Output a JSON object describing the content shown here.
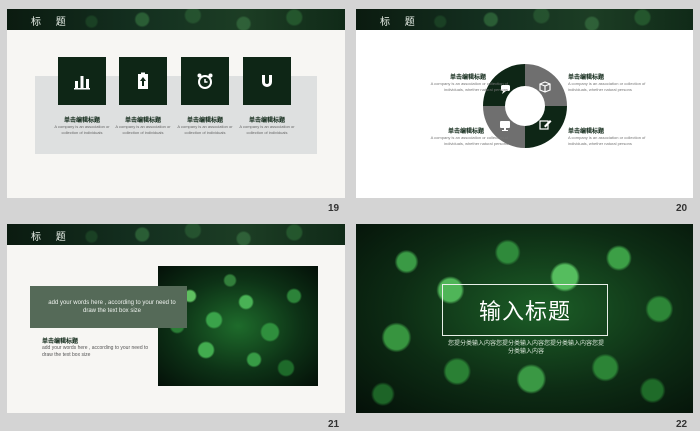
{
  "slides": [
    {
      "number": "19",
      "header": "标 题",
      "items": [
        {
          "icon": "bar-chart-icon",
          "title": "单击编辑标题",
          "text": "A company is an association or collection of individuals"
        },
        {
          "icon": "battery-upload-icon",
          "title": "单击编辑标题",
          "text": "A company is an association or collection of individuals"
        },
        {
          "icon": "alarm-clock-icon",
          "title": "单击编辑标题",
          "text": "A company is an association or collection of individuals"
        },
        {
          "icon": "magnet-icon",
          "title": "单击编辑标题",
          "text": "A company is an association or collection of individuals"
        }
      ]
    },
    {
      "number": "20",
      "header": "标 题",
      "items": [
        {
          "title": "单击编辑标题",
          "text": "A company is an association or collection of individuals, whether natural persons"
        },
        {
          "title": "单击编辑标题",
          "text": "A company is an association or collection of individuals, whether natural persons"
        },
        {
          "title": "单击编辑标题",
          "text": "A company is an association or collection of individuals, whether natural persons"
        },
        {
          "title": "单击编辑标题",
          "text": "A company is an association or collection of individuals, whether natural persons"
        }
      ],
      "ring_icons": [
        "chat-bubble-icon",
        "cube-icon",
        "monitor-icon",
        "edit-icon"
      ]
    },
    {
      "number": "21",
      "header": "标 题",
      "box_text": "add your words here , according to your need to draw the text box size",
      "title": "单击编辑标题",
      "text": "add your words here , according to your need to draw the text box size"
    },
    {
      "number": "22",
      "title": "输入标题",
      "subtitle": "您提分类输入内容您提分类输入内容您提分类输入内容您提分类输入内容"
    }
  ],
  "colors": {
    "dark_green": "#0e2616",
    "panel_gray": "#dee0e0",
    "ring_gray": "#6f6f6f",
    "box_green": "#556a58"
  }
}
